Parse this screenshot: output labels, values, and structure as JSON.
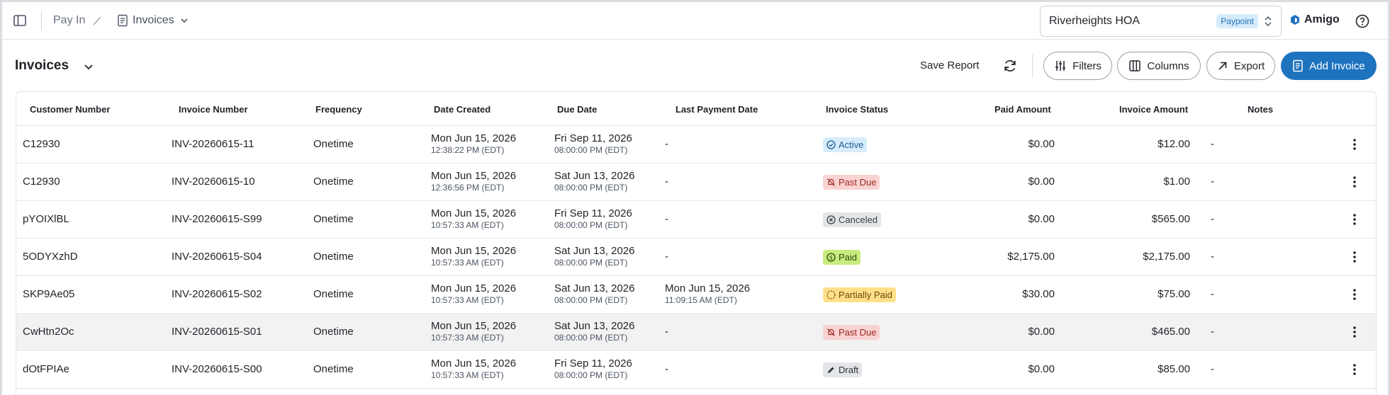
{
  "breadcrumb": {
    "parent": "Pay In",
    "current": "Invoices"
  },
  "org": {
    "name": "Riverheights HOA",
    "badge": "Paypoint"
  },
  "brand": {
    "name": "Amigo"
  },
  "header": {
    "title": "Invoices",
    "save_report": "Save Report",
    "filters": "Filters",
    "columns": "Columns",
    "export": "Export",
    "add_invoice": "Add Invoice"
  },
  "table": {
    "columns": [
      "Customer Number",
      "Invoice Number",
      "Frequency",
      "Date Created",
      "Due Date",
      "Last Payment Date",
      "Invoice Status",
      "Paid Amount",
      "Invoice Amount",
      "Notes"
    ],
    "rows": [
      {
        "customer": "C12930",
        "invoice": "INV-20260615-11",
        "frequency": "Onetime",
        "created_date": "Mon Jun 15, 2026",
        "created_time": "12:38:22 PM (EDT)",
        "due_date": "Fri Sep 11, 2026",
        "due_time": "08:00:00 PM (EDT)",
        "last_payment": "-",
        "last_payment_time": "",
        "status": "Active",
        "status_type": "active",
        "paid": "$0.00",
        "amount": "$12.00",
        "notes": "-"
      },
      {
        "customer": "C12930",
        "invoice": "INV-20260615-10",
        "frequency": "Onetime",
        "created_date": "Mon Jun 15, 2026",
        "created_time": "12:36:56 PM (EDT)",
        "due_date": "Sat Jun 13, 2026",
        "due_time": "08:00:00 PM (EDT)",
        "last_payment": "-",
        "last_payment_time": "",
        "status": "Past Due",
        "status_type": "pastdue",
        "paid": "$0.00",
        "amount": "$1.00",
        "notes": "-"
      },
      {
        "customer": "pYOIXlBL",
        "invoice": "INV-20260615-S99",
        "frequency": "Onetime",
        "created_date": "Mon Jun 15, 2026",
        "created_time": "10:57:33 AM (EDT)",
        "due_date": "Fri Sep 11, 2026",
        "due_time": "08:00:00 PM (EDT)",
        "last_payment": "-",
        "last_payment_time": "",
        "status": "Canceled",
        "status_type": "canceled",
        "paid": "$0.00",
        "amount": "$565.00",
        "notes": "-"
      },
      {
        "customer": "5ODYXzhD",
        "invoice": "INV-20260615-S04",
        "frequency": "Onetime",
        "created_date": "Mon Jun 15, 2026",
        "created_time": "10:57:33 AM (EDT)",
        "due_date": "Sat Jun 13, 2026",
        "due_time": "08:00:00 PM (EDT)",
        "last_payment": "-",
        "last_payment_time": "",
        "status": "Paid",
        "status_type": "paid",
        "paid": "$2,175.00",
        "amount": "$2,175.00",
        "notes": "-"
      },
      {
        "customer": "SKP9Ae05",
        "invoice": "INV-20260615-S02",
        "frequency": "Onetime",
        "created_date": "Mon Jun 15, 2026",
        "created_time": "10:57:33 AM (EDT)",
        "due_date": "Sat Jun 13, 2026",
        "due_time": "08:00:00 PM (EDT)",
        "last_payment": "Mon Jun 15, 2026",
        "last_payment_time": "11:09:15 AM (EDT)",
        "status": "Partially Paid",
        "status_type": "partial",
        "paid": "$30.00",
        "amount": "$75.00",
        "notes": "-"
      },
      {
        "customer": "CwHtn2Oc",
        "invoice": "INV-20260615-S01",
        "frequency": "Onetime",
        "created_date": "Mon Jun 15, 2026",
        "created_time": "10:57:33 AM (EDT)",
        "due_date": "Sat Jun 13, 2026",
        "due_time": "08:00:00 PM (EDT)",
        "last_payment": "-",
        "last_payment_time": "",
        "status": "Past Due",
        "status_type": "pastdue",
        "paid": "$0.00",
        "amount": "$465.00",
        "notes": "-"
      },
      {
        "customer": "dOtFPIAe",
        "invoice": "INV-20260615-S00",
        "frequency": "Onetime",
        "created_date": "Mon Jun 15, 2026",
        "created_time": "10:57:33 AM (EDT)",
        "due_date": "Fri Sep 11, 2026",
        "due_time": "08:00:00 PM (EDT)",
        "last_payment": "-",
        "last_payment_time": "",
        "status": "Draft",
        "status_type": "draft",
        "paid": "$0.00",
        "amount": "$85.00",
        "notes": "-"
      }
    ]
  },
  "colors": {
    "primary": "#1e73be",
    "badge_bg": "#d6ecfb",
    "row_hover": "#f2f2f3"
  }
}
